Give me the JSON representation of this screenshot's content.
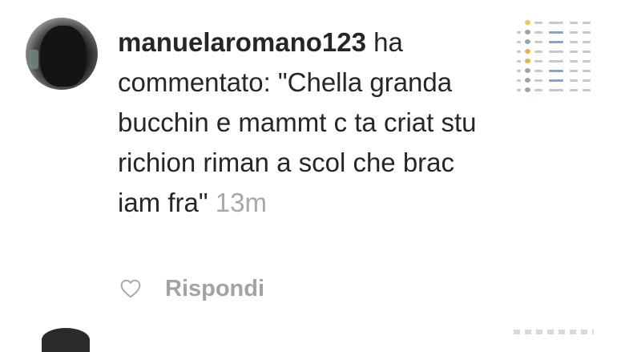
{
  "notification": {
    "username": "manuelaromano123",
    "action": "ha commentato:",
    "comment_text": "\"Chella granda bucchin e mammt c ta criat stu richion riman a scol che brac iam fra\"",
    "time": "13m",
    "reply_label": "Rispondi",
    "heart_icon": "heart-outline-icon"
  },
  "colors": {
    "text": "#262626",
    "secondary": "#a8a8a8",
    "background": "#ffffff"
  }
}
